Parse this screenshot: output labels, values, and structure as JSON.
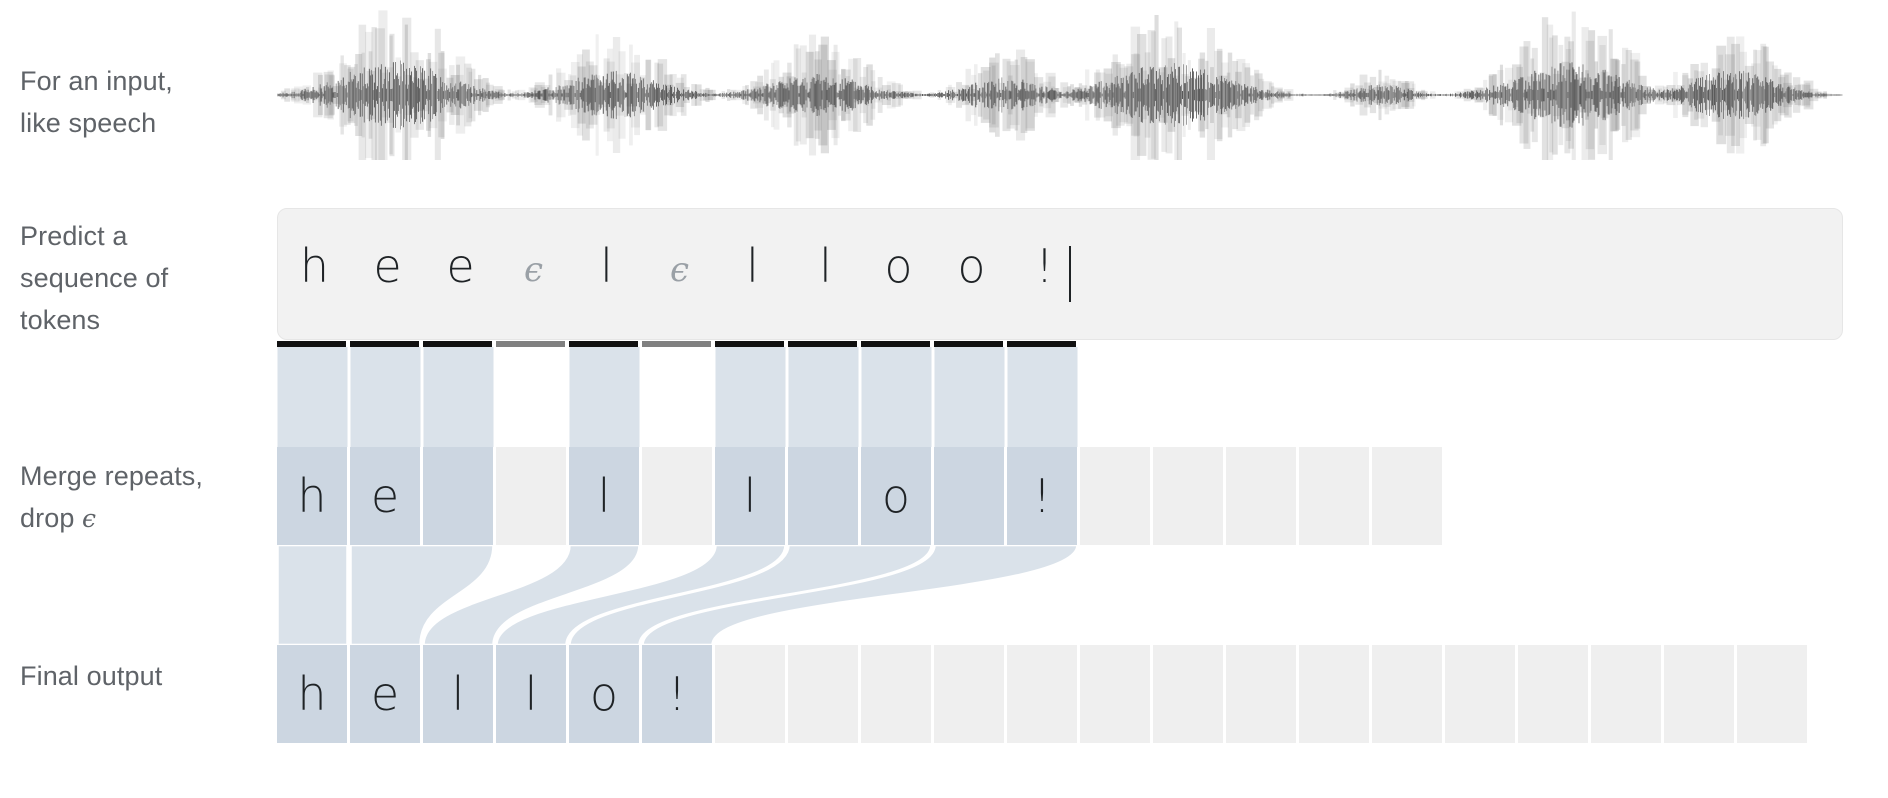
{
  "labels": {
    "waveform": "For an input,\nlike speech",
    "tokens": "Predict a\nsequence of\ntokens",
    "merge_prefix": "Merge repeats,\ndrop ",
    "merge_symbol": "ϵ",
    "final": "Final output"
  },
  "colors": {
    "text": "#1f2326",
    "label_text": "#5f6368",
    "panel_bg": "#f2f2f2",
    "panel_border": "#e6e6e6",
    "cell_active": "#ccd6e1",
    "cell_empty": "#efefef",
    "ribbon": "#dae2ea",
    "ribbon_light": "#e2e9ef",
    "bar_token": "#111111",
    "bar_blank": "#808080",
    "blank_text": "#9aa0a6",
    "waveform": "#4a4a4a"
  },
  "tokens": {
    "count": 11,
    "items": [
      {
        "char": "h",
        "blank": false
      },
      {
        "char": "e",
        "blank": false
      },
      {
        "char": "e",
        "blank": false
      },
      {
        "char": "ϵ",
        "blank": true
      },
      {
        "char": "l",
        "blank": false
      },
      {
        "char": "ϵ",
        "blank": true
      },
      {
        "char": "l",
        "blank": false
      },
      {
        "char": "l",
        "blank": false
      },
      {
        "char": "o",
        "blank": false
      },
      {
        "char": "o",
        "blank": false
      },
      {
        "char": "!",
        "blank": false
      }
    ],
    "caret_after_index": 10
  },
  "merge_row": {
    "cells": [
      {
        "char": "h",
        "state": "on"
      },
      {
        "char": "e",
        "state": "on"
      },
      {
        "char": "",
        "state": "on"
      },
      {
        "char": "",
        "state": "off"
      },
      {
        "char": "l",
        "state": "on"
      },
      {
        "char": "",
        "state": "off"
      },
      {
        "char": "l",
        "state": "on"
      },
      {
        "char": "",
        "state": "on"
      },
      {
        "char": "o",
        "state": "on"
      },
      {
        "char": "",
        "state": "on"
      },
      {
        "char": "!",
        "state": "on"
      },
      {
        "char": "",
        "state": "ph"
      },
      {
        "char": "",
        "state": "ph"
      },
      {
        "char": "",
        "state": "ph"
      },
      {
        "char": "",
        "state": "ph"
      },
      {
        "char": "",
        "state": "ph"
      }
    ]
  },
  "final_row": {
    "text": "hello!",
    "cells": [
      {
        "char": "h",
        "state": "on"
      },
      {
        "char": "e",
        "state": "on"
      },
      {
        "char": "l",
        "state": "on"
      },
      {
        "char": "l",
        "state": "on"
      },
      {
        "char": "o",
        "state": "on"
      },
      {
        "char": "!",
        "state": "on"
      },
      {
        "char": "",
        "state": "ph"
      },
      {
        "char": "",
        "state": "ph"
      },
      {
        "char": "",
        "state": "ph"
      },
      {
        "char": "",
        "state": "ph"
      },
      {
        "char": "",
        "state": "ph"
      },
      {
        "char": "",
        "state": "ph"
      },
      {
        "char": "",
        "state": "ph"
      },
      {
        "char": "",
        "state": "ph"
      },
      {
        "char": "",
        "state": "ph"
      },
      {
        "char": "",
        "state": "ph"
      },
      {
        "char": "",
        "state": "ph"
      },
      {
        "char": "",
        "state": "ph"
      },
      {
        "char": "",
        "state": "ph"
      },
      {
        "char": "",
        "state": "ph"
      },
      {
        "char": "",
        "state": "ph"
      }
    ]
  },
  "waveform": {
    "description": "speech-waveform",
    "bursts": [
      {
        "center": 0.075,
        "width": 0.055,
        "amp": 1.0
      },
      {
        "center": 0.215,
        "width": 0.05,
        "amp": 0.68
      },
      {
        "center": 0.345,
        "width": 0.05,
        "amp": 0.62
      },
      {
        "center": 0.465,
        "width": 0.04,
        "amp": 0.5
      },
      {
        "center": 0.57,
        "width": 0.06,
        "amp": 0.92
      },
      {
        "center": 0.705,
        "width": 0.03,
        "amp": 0.3
      },
      {
        "center": 0.825,
        "width": 0.055,
        "amp": 0.95
      },
      {
        "center": 0.93,
        "width": 0.045,
        "amp": 0.72
      }
    ]
  },
  "flows": [
    {
      "from": [
        0
      ],
      "to": 0
    },
    {
      "from": [
        1,
        2
      ],
      "to": 1
    },
    {
      "from": [
        4
      ],
      "to": 2
    },
    {
      "from": [
        6
      ],
      "to": 3
    },
    {
      "from": [
        7,
        8
      ],
      "to": 4
    },
    {
      "from": [
        9,
        10
      ],
      "to": 5
    }
  ]
}
